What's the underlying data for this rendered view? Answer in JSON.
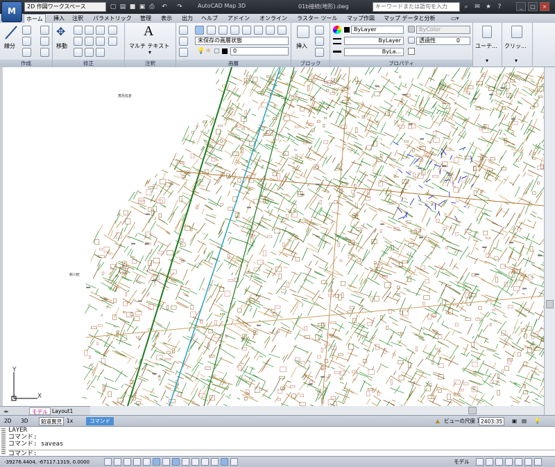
{
  "titlebar": {
    "app_button": "M",
    "workspace": "2D 作図ワークスペース",
    "app_title": "AutoCAD Map 3D",
    "file_title": "01b接続(地形).dwg",
    "search_placeholder": "キーワードまたは語句を入力",
    "window_buttons": [
      "_",
      "□",
      "×"
    ]
  },
  "tabs": [
    "ホーム",
    "挿入",
    "注釈",
    "パラメトリック",
    "管理",
    "表示",
    "出力",
    "ヘルプ",
    "アドイン",
    "オンライン",
    "ラスター ツール",
    "マップ作図",
    "マップ データと分析"
  ],
  "ribbon": {
    "draw": {
      "title": "作成",
      "line_label": "線分"
    },
    "modify": {
      "title": "修正",
      "move_label": "移動"
    },
    "annotation": {
      "title": "注釈",
      "mtext_glyph": "A",
      "mtext_label": "マルチ テキスト"
    },
    "layers": {
      "title": "画層",
      "layer_state": "未保存の画層状態",
      "current_layer": "0"
    },
    "block": {
      "title": "ブロック",
      "insert_label": "挿入"
    },
    "properties": {
      "title": "プロパティ",
      "color": "ByLayer",
      "linetype": "ByLayer",
      "lineweight": "ByLa...",
      "plot_style": "ByColor",
      "transparency_label": "透過性",
      "transparency_value": "0"
    },
    "utilities": {
      "label": "ユーテ..."
    },
    "clipboard": {
      "label": "クリッ..."
    }
  },
  "drawing": {
    "label_top": "蔦島佐倉",
    "label_left": "新川町",
    "ucs_x": "X",
    "ucs_y": "Y"
  },
  "layout_tabs": [
    "モデル",
    "Layout1"
  ],
  "statusbar1": {
    "view_2d": "2D",
    "view_3d": "3D",
    "map_name": "鉛道異児",
    "zoom": "1x",
    "command_label": "コマンド",
    "annotation_scale": "ビューの尺度 1",
    "scale_value": "2403:35"
  },
  "command_window": {
    "lines": [
      "LAYER",
      "コマンド:",
      "コマンド: saveas"
    ],
    "prompt": "コマンド:"
  },
  "statusbar2": {
    "coordinates": "-39276.4404, -67117.1319, 0.0000",
    "model_label": "モデル"
  }
}
